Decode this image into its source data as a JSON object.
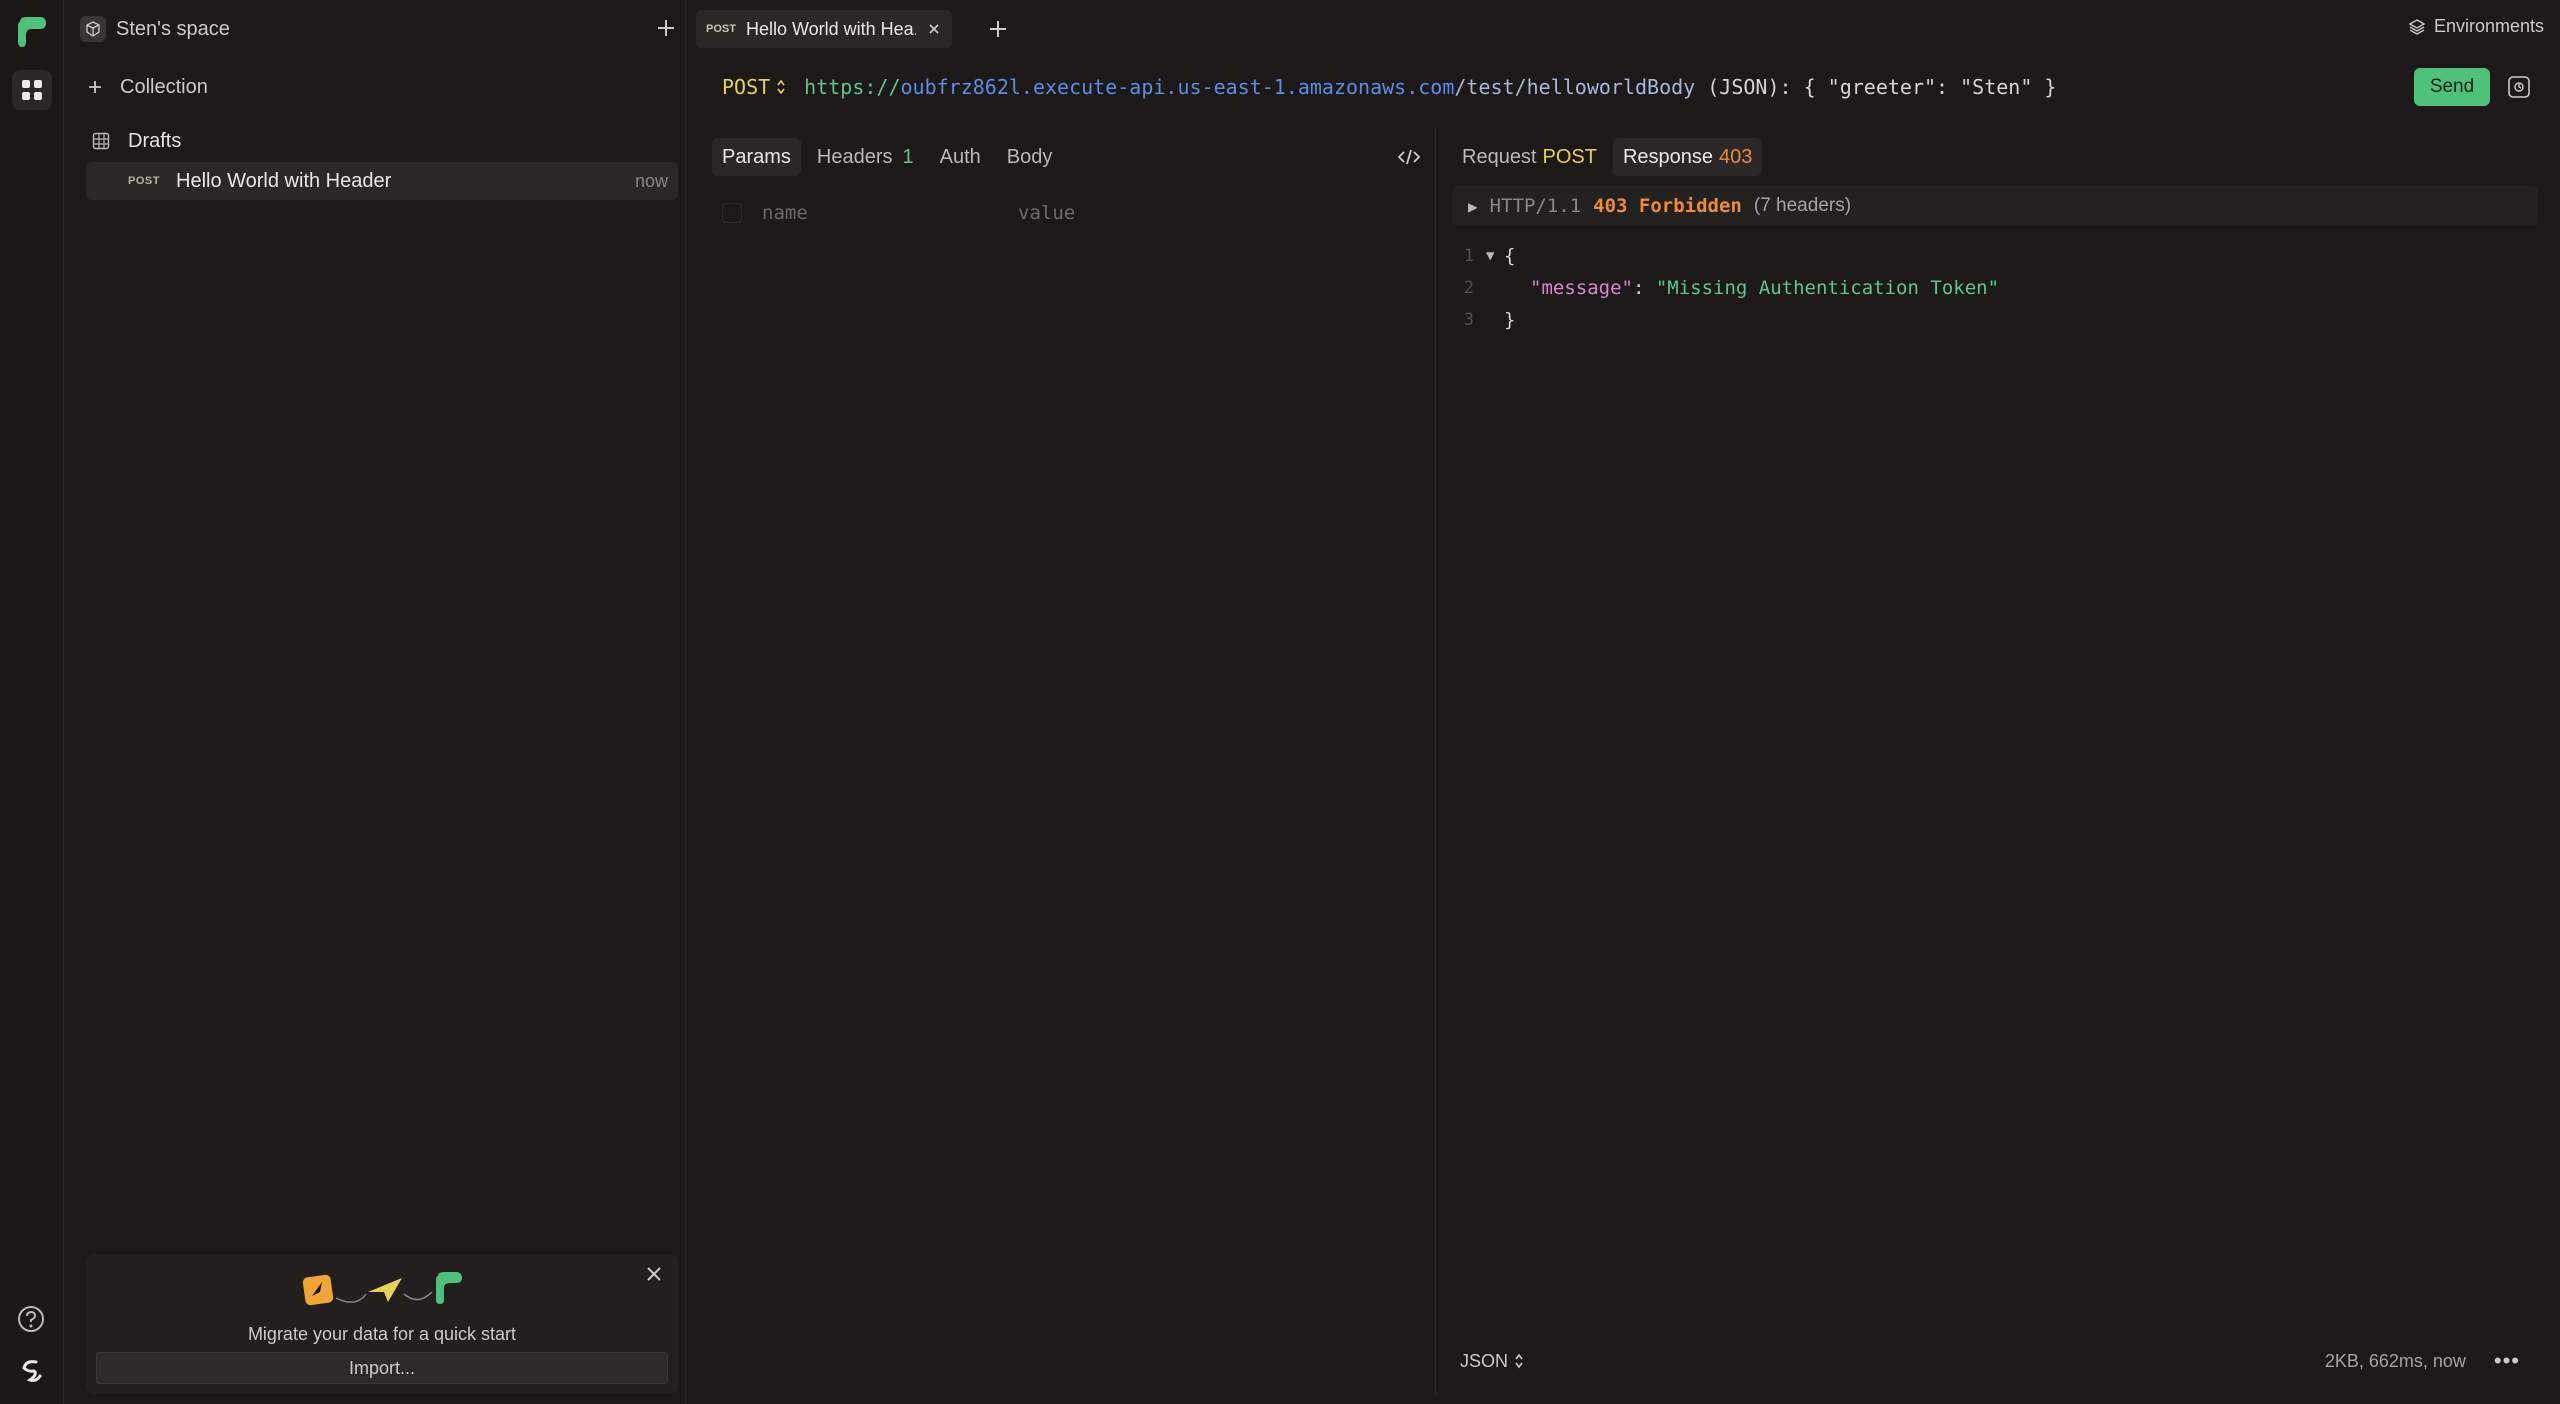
{
  "sidebar": {
    "space_name": "Sten's space",
    "collection_label": "Collection",
    "drafts_label": "Drafts",
    "request_item": {
      "method": "POST",
      "name": "Hello World with Header",
      "time": "now"
    },
    "migrate": {
      "text": "Migrate your data for a quick start",
      "import_label": "Import..."
    }
  },
  "tabs": {
    "active": {
      "method": "POST",
      "name": "Hello World with Hea..."
    },
    "environments_label": "Environments"
  },
  "request": {
    "method": "POST",
    "url_scheme": "https://",
    "url_host": "oubfrz862l.execute-api.us-east-1.amazonaws.com",
    "url_path": "/test/helloworldBody",
    "url_rest": " (JSON): { \"greeter\": \"Sten\" }",
    "send_label": "Send",
    "subtabs": {
      "params": "Params",
      "headers": "Headers",
      "headers_count": "1",
      "auth": "Auth",
      "body": "Body"
    },
    "param_name_placeholder": "name",
    "param_value_placeholder": "value"
  },
  "response": {
    "request_tab_label": "Request",
    "request_tab_method": "POST",
    "response_tab_label": "Response",
    "response_tab_status": "403",
    "status_protocol": "HTTP/1.1",
    "status_text": "403 Forbidden",
    "status_headers": "(7 headers)",
    "body_lines": [
      {
        "n": "1",
        "fold": "▼",
        "text": "{"
      },
      {
        "n": "2",
        "key": "\"message\"",
        "value": "\"Missing Authentication Token\""
      },
      {
        "n": "3",
        "text": "}"
      }
    ],
    "format_label": "JSON",
    "meta": "2KB, 662ms, now"
  },
  "colors": {
    "accent_green": "#4fc17a",
    "method_yellow": "#e7d15a",
    "status_orange": "#ec8a3e",
    "url_blue": "#5a8de6"
  }
}
